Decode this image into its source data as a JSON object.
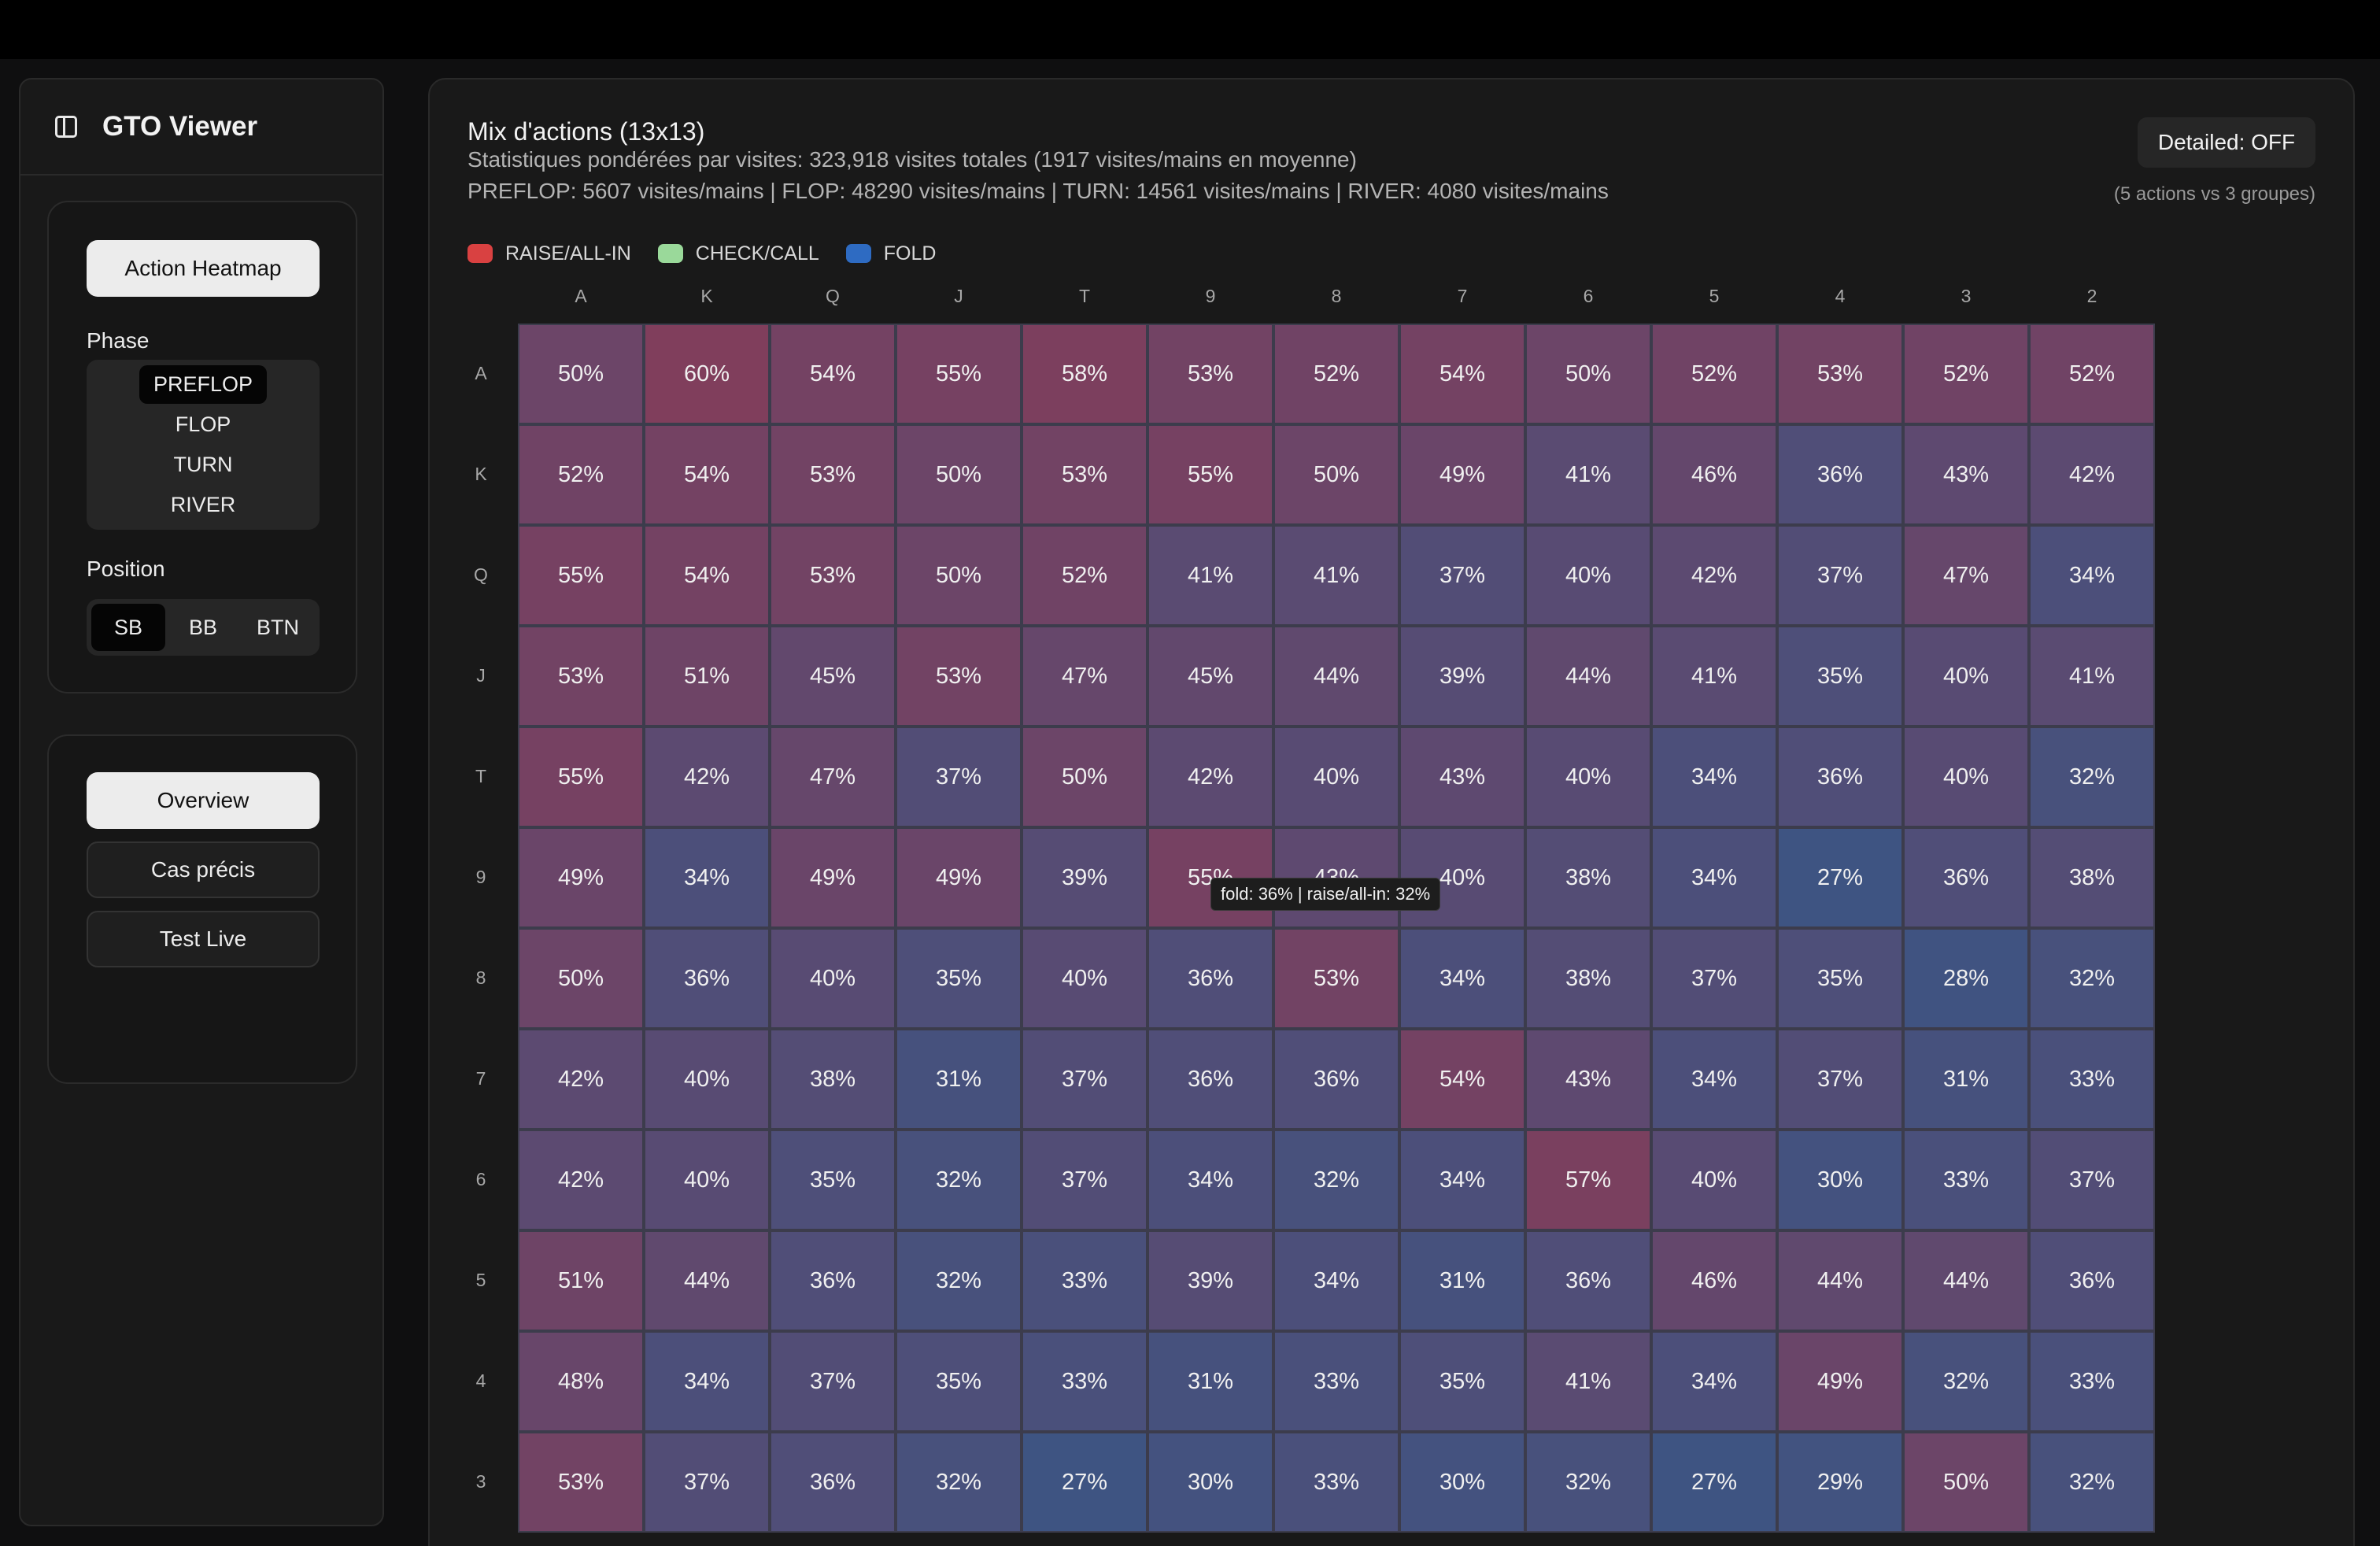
{
  "sidebar": {
    "title": "GTO Viewer",
    "heatmap_button": "Action Heatmap",
    "phase_label": "Phase",
    "phases": [
      "PREFLOP",
      "FLOP",
      "TURN",
      "RIVER"
    ],
    "active_phase": "PREFLOP",
    "position_label": "Position",
    "positions": [
      "SB",
      "BB",
      "BTN"
    ],
    "active_position": "SB",
    "nav": [
      "Overview",
      "Cas précis",
      "Test Live"
    ],
    "active_nav": "Overview"
  },
  "main": {
    "title": "Mix d'actions (13x13)",
    "subtitle_1": "Statistiques pondérées par visites: 323,918 visites totales (1917 visites/mains en moyenne)",
    "subtitle_2": "PREFLOP: 5607 visites/mains | FLOP: 48290 visites/mains | TURN: 14561 visites/mains | RIVER: 4080 visites/mains",
    "detailed_toggle": "Detailed: OFF",
    "groups_note": "(5 actions vs 3 groupes)",
    "legend": [
      {
        "label": "RAISE/ALL-IN",
        "color": "#d94141"
      },
      {
        "label": "CHECK/CALL",
        "color": "#9ad99a"
      },
      {
        "label": "FOLD",
        "color": "#2e6bc2"
      }
    ],
    "tooltip": "fold: 36% | raise/all-in: 32%"
  },
  "heatmap": {
    "col_labels": [
      "A",
      "K",
      "Q",
      "J",
      "T",
      "9",
      "8",
      "7",
      "6",
      "5",
      "4",
      "3",
      "2"
    ],
    "row_labels": [
      "A",
      "K",
      "Q",
      "J",
      "T",
      "9",
      "8",
      "7",
      "6",
      "5",
      "4",
      "3"
    ],
    "rows": [
      [
        50,
        60,
        54,
        55,
        58,
        53,
        52,
        54,
        50,
        52,
        53,
        52,
        52
      ],
      [
        52,
        54,
        53,
        50,
        53,
        55,
        50,
        49,
        41,
        46,
        36,
        43,
        42
      ],
      [
        55,
        54,
        53,
        50,
        52,
        41,
        41,
        37,
        40,
        42,
        37,
        47,
        34
      ],
      [
        53,
        51,
        45,
        53,
        47,
        45,
        44,
        39,
        44,
        41,
        35,
        40,
        41
      ],
      [
        55,
        42,
        47,
        37,
        50,
        42,
        40,
        43,
        40,
        34,
        36,
        40,
        32
      ],
      [
        49,
        34,
        49,
        49,
        39,
        55,
        43,
        40,
        38,
        34,
        27,
        36,
        38
      ],
      [
        50,
        36,
        40,
        35,
        40,
        36,
        53,
        34,
        38,
        37,
        35,
        28,
        32
      ],
      [
        42,
        40,
        38,
        31,
        37,
        36,
        36,
        54,
        43,
        34,
        37,
        31,
        33
      ],
      [
        42,
        40,
        35,
        32,
        37,
        34,
        32,
        34,
        57,
        40,
        30,
        33,
        37
      ],
      [
        51,
        44,
        36,
        32,
        33,
        39,
        34,
        31,
        36,
        46,
        44,
        44,
        36
      ],
      [
        48,
        34,
        37,
        35,
        33,
        31,
        33,
        35,
        41,
        34,
        49,
        32,
        33
      ],
      [
        53,
        37,
        36,
        32,
        27,
        30,
        33,
        30,
        32,
        27,
        29,
        50,
        32
      ]
    ]
  }
}
